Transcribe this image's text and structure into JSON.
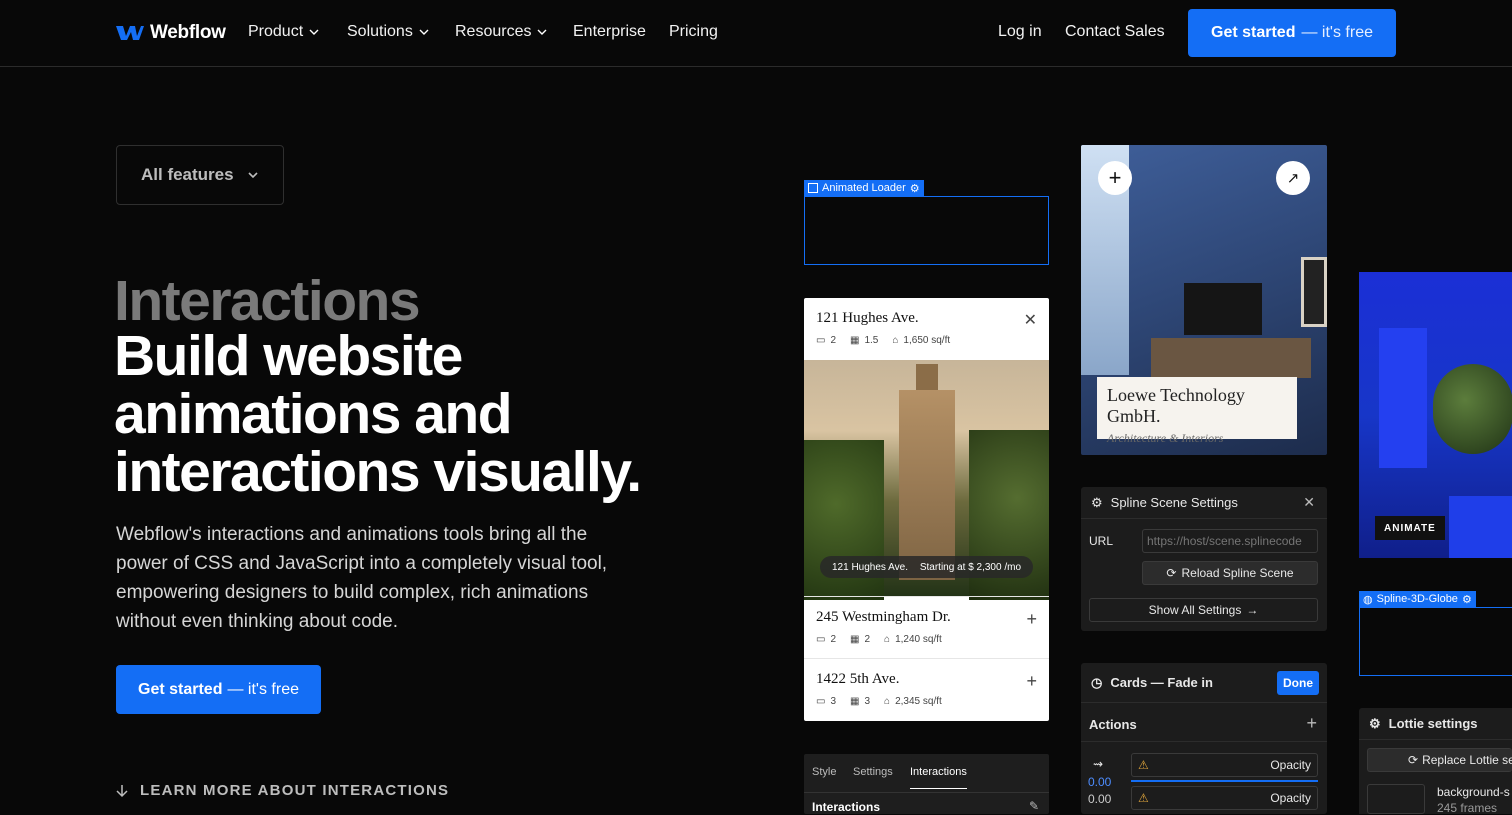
{
  "nav": {
    "brand": "Webflow",
    "items": [
      "Product",
      "Solutions",
      "Resources",
      "Enterprise",
      "Pricing"
    ],
    "login": "Log in",
    "contact": "Contact Sales",
    "cta_bold": "Get started",
    "cta_light": "— it's free"
  },
  "filter": {
    "label": "All features"
  },
  "hero": {
    "eyebrow": "Interactions",
    "headline": "Build website animations and interactions visually.",
    "lead": "Webflow's interactions and animations tools bring all the power of CSS and JavaScript into a completely visual tool, empowering designers to build complex, rich animations without even thinking about code.",
    "cta_bold": "Get started",
    "cta_light": "— it's free",
    "learn_more": "LEARN MORE ABOUT INTERACTIONS"
  },
  "loader": {
    "tag": "Animated Loader"
  },
  "listings": [
    {
      "address": "121 Hughes Ave.",
      "beds": "2",
      "baths": "1.5",
      "area": "1,650 sq/ft"
    },
    {
      "address": "245 Westmingham Dr.",
      "beds": "2",
      "baths": "2",
      "area": "1,240 sq/ft"
    },
    {
      "address": "1422 5th Ave.",
      "beds": "3",
      "baths": "3",
      "area": "2,345 sq/ft"
    }
  ],
  "photo_pill": {
    "left": "121 Hughes Ave.",
    "right": "Starting at $ 2,300 /mo"
  },
  "style_tabs": {
    "tabs": [
      "Style",
      "Settings",
      "Interactions"
    ],
    "section": "Interactions"
  },
  "brand_card": {
    "name": "Loewe Technology GmbH.",
    "sub": "Architecture & Interiors"
  },
  "spline": {
    "title": "Spline Scene Settings",
    "url_label": "URL",
    "url_placeholder": "https://host/scene.splinecode",
    "reload": "Reload Spline Scene",
    "show_all": "Show All Settings"
  },
  "animate_badge": "ANIMATE",
  "globe": {
    "tag": "Spline-3D-Globe"
  },
  "cards_panel": {
    "title": "Cards — Fade in",
    "done": "Done",
    "actions": "Actions",
    "rows": [
      {
        "value": "0.00",
        "label": "Opacity"
      },
      {
        "value": "0.00",
        "label": "Opacity"
      }
    ]
  },
  "lottie": {
    "title": "Lottie settings",
    "replace": "Replace Lottie se",
    "file": "background-s",
    "frames": "245 frames"
  },
  "colors": {
    "accent": "#146ef5",
    "bg": "#080808"
  }
}
